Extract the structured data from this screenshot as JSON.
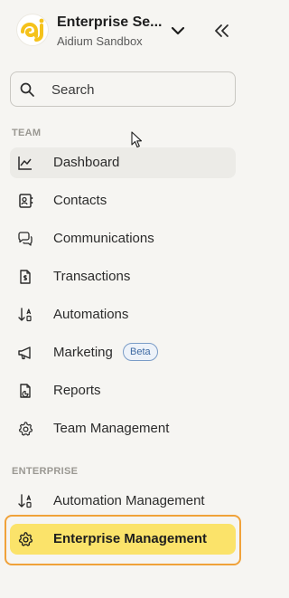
{
  "header": {
    "org_name": "Enterprise Se...",
    "org_sub": "Aidium Sandbox"
  },
  "search": {
    "label": "Search"
  },
  "sections": {
    "team": "TEAM",
    "enterprise": "ENTERPRISE"
  },
  "team_items": [
    {
      "label": "Dashboard",
      "icon": "chart-line-icon"
    },
    {
      "label": "Contacts",
      "icon": "contacts-icon"
    },
    {
      "label": "Communications",
      "icon": "chat-icon"
    },
    {
      "label": "Transactions",
      "icon": "document-icon"
    },
    {
      "label": "Automations",
      "icon": "sort-icon"
    },
    {
      "label": "Marketing",
      "icon": "megaphone-icon",
      "badge": "Beta"
    },
    {
      "label": "Reports",
      "icon": "report-icon"
    },
    {
      "label": "Team Management",
      "icon": "gear-icon"
    }
  ],
  "enterprise_items": [
    {
      "label": "Automation Management",
      "icon": "sort-icon"
    },
    {
      "label": "Enterprise Management",
      "icon": "gear-icon"
    }
  ],
  "colors": {
    "background": "#f6f5f2",
    "logo_yellow": "#f5c21b",
    "selected_bg": "#fbe36a",
    "highlight_border": "#f0a23a",
    "beta_border": "#7a9cc7"
  }
}
